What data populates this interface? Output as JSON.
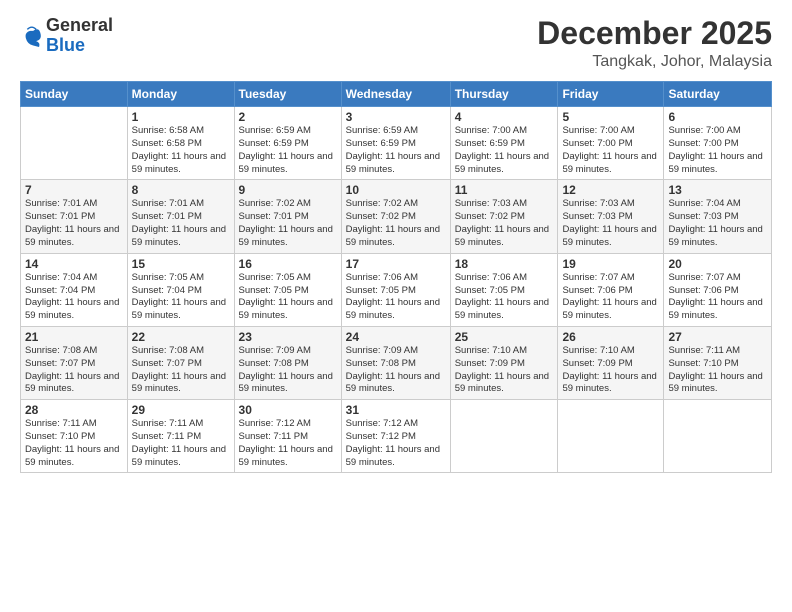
{
  "logo": {
    "general": "General",
    "blue": "Blue"
  },
  "header": {
    "month": "December 2025",
    "location": "Tangkak, Johor, Malaysia"
  },
  "weekdays": [
    "Sunday",
    "Monday",
    "Tuesday",
    "Wednesday",
    "Thursday",
    "Friday",
    "Saturday"
  ],
  "weeks": [
    [
      {
        "day": "",
        "sunrise": "",
        "sunset": "",
        "daylight": ""
      },
      {
        "day": "1",
        "sunrise": "Sunrise: 6:58 AM",
        "sunset": "Sunset: 6:58 PM",
        "daylight": "Daylight: 11 hours and 59 minutes."
      },
      {
        "day": "2",
        "sunrise": "Sunrise: 6:59 AM",
        "sunset": "Sunset: 6:59 PM",
        "daylight": "Daylight: 11 hours and 59 minutes."
      },
      {
        "day": "3",
        "sunrise": "Sunrise: 6:59 AM",
        "sunset": "Sunset: 6:59 PM",
        "daylight": "Daylight: 11 hours and 59 minutes."
      },
      {
        "day": "4",
        "sunrise": "Sunrise: 7:00 AM",
        "sunset": "Sunset: 6:59 PM",
        "daylight": "Daylight: 11 hours and 59 minutes."
      },
      {
        "day": "5",
        "sunrise": "Sunrise: 7:00 AM",
        "sunset": "Sunset: 7:00 PM",
        "daylight": "Daylight: 11 hours and 59 minutes."
      },
      {
        "day": "6",
        "sunrise": "Sunrise: 7:00 AM",
        "sunset": "Sunset: 7:00 PM",
        "daylight": "Daylight: 11 hours and 59 minutes."
      }
    ],
    [
      {
        "day": "7",
        "sunrise": "Sunrise: 7:01 AM",
        "sunset": "Sunset: 7:01 PM",
        "daylight": "Daylight: 11 hours and 59 minutes."
      },
      {
        "day": "8",
        "sunrise": "Sunrise: 7:01 AM",
        "sunset": "Sunset: 7:01 PM",
        "daylight": "Daylight: 11 hours and 59 minutes."
      },
      {
        "day": "9",
        "sunrise": "Sunrise: 7:02 AM",
        "sunset": "Sunset: 7:01 PM",
        "daylight": "Daylight: 11 hours and 59 minutes."
      },
      {
        "day": "10",
        "sunrise": "Sunrise: 7:02 AM",
        "sunset": "Sunset: 7:02 PM",
        "daylight": "Daylight: 11 hours and 59 minutes."
      },
      {
        "day": "11",
        "sunrise": "Sunrise: 7:03 AM",
        "sunset": "Sunset: 7:02 PM",
        "daylight": "Daylight: 11 hours and 59 minutes."
      },
      {
        "day": "12",
        "sunrise": "Sunrise: 7:03 AM",
        "sunset": "Sunset: 7:03 PM",
        "daylight": "Daylight: 11 hours and 59 minutes."
      },
      {
        "day": "13",
        "sunrise": "Sunrise: 7:04 AM",
        "sunset": "Sunset: 7:03 PM",
        "daylight": "Daylight: 11 hours and 59 minutes."
      }
    ],
    [
      {
        "day": "14",
        "sunrise": "Sunrise: 7:04 AM",
        "sunset": "Sunset: 7:04 PM",
        "daylight": "Daylight: 11 hours and 59 minutes."
      },
      {
        "day": "15",
        "sunrise": "Sunrise: 7:05 AM",
        "sunset": "Sunset: 7:04 PM",
        "daylight": "Daylight: 11 hours and 59 minutes."
      },
      {
        "day": "16",
        "sunrise": "Sunrise: 7:05 AM",
        "sunset": "Sunset: 7:05 PM",
        "daylight": "Daylight: 11 hours and 59 minutes."
      },
      {
        "day": "17",
        "sunrise": "Sunrise: 7:06 AM",
        "sunset": "Sunset: 7:05 PM",
        "daylight": "Daylight: 11 hours and 59 minutes."
      },
      {
        "day": "18",
        "sunrise": "Sunrise: 7:06 AM",
        "sunset": "Sunset: 7:05 PM",
        "daylight": "Daylight: 11 hours and 59 minutes."
      },
      {
        "day": "19",
        "sunrise": "Sunrise: 7:07 AM",
        "sunset": "Sunset: 7:06 PM",
        "daylight": "Daylight: 11 hours and 59 minutes."
      },
      {
        "day": "20",
        "sunrise": "Sunrise: 7:07 AM",
        "sunset": "Sunset: 7:06 PM",
        "daylight": "Daylight: 11 hours and 59 minutes."
      }
    ],
    [
      {
        "day": "21",
        "sunrise": "Sunrise: 7:08 AM",
        "sunset": "Sunset: 7:07 PM",
        "daylight": "Daylight: 11 hours and 59 minutes."
      },
      {
        "day": "22",
        "sunrise": "Sunrise: 7:08 AM",
        "sunset": "Sunset: 7:07 PM",
        "daylight": "Daylight: 11 hours and 59 minutes."
      },
      {
        "day": "23",
        "sunrise": "Sunrise: 7:09 AM",
        "sunset": "Sunset: 7:08 PM",
        "daylight": "Daylight: 11 hours and 59 minutes."
      },
      {
        "day": "24",
        "sunrise": "Sunrise: 7:09 AM",
        "sunset": "Sunset: 7:08 PM",
        "daylight": "Daylight: 11 hours and 59 minutes."
      },
      {
        "day": "25",
        "sunrise": "Sunrise: 7:10 AM",
        "sunset": "Sunset: 7:09 PM",
        "daylight": "Daylight: 11 hours and 59 minutes."
      },
      {
        "day": "26",
        "sunrise": "Sunrise: 7:10 AM",
        "sunset": "Sunset: 7:09 PM",
        "daylight": "Daylight: 11 hours and 59 minutes."
      },
      {
        "day": "27",
        "sunrise": "Sunrise: 7:11 AM",
        "sunset": "Sunset: 7:10 PM",
        "daylight": "Daylight: 11 hours and 59 minutes."
      }
    ],
    [
      {
        "day": "28",
        "sunrise": "Sunrise: 7:11 AM",
        "sunset": "Sunset: 7:10 PM",
        "daylight": "Daylight: 11 hours and 59 minutes."
      },
      {
        "day": "29",
        "sunrise": "Sunrise: 7:11 AM",
        "sunset": "Sunset: 7:11 PM",
        "daylight": "Daylight: 11 hours and 59 minutes."
      },
      {
        "day": "30",
        "sunrise": "Sunrise: 7:12 AM",
        "sunset": "Sunset: 7:11 PM",
        "daylight": "Daylight: 11 hours and 59 minutes."
      },
      {
        "day": "31",
        "sunrise": "Sunrise: 7:12 AM",
        "sunset": "Sunset: 7:12 PM",
        "daylight": "Daylight: 11 hours and 59 minutes."
      },
      {
        "day": "",
        "sunrise": "",
        "sunset": "",
        "daylight": ""
      },
      {
        "day": "",
        "sunrise": "",
        "sunset": "",
        "daylight": ""
      },
      {
        "day": "",
        "sunrise": "",
        "sunset": "",
        "daylight": ""
      }
    ]
  ]
}
